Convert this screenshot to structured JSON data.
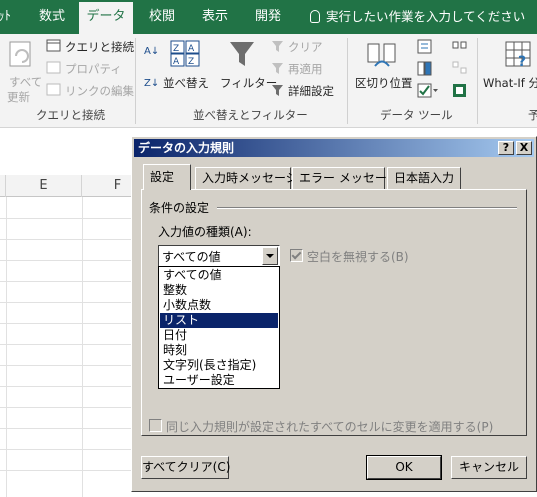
{
  "ribbon": {
    "tabs": [
      {
        "label": "ｯﾄ"
      },
      {
        "label": "数式"
      },
      {
        "label": "データ"
      },
      {
        "label": "校閲"
      },
      {
        "label": "表示"
      },
      {
        "label": "開発"
      }
    ],
    "tell_me": "実行したい作業を入力してください",
    "get_transform": {
      "refresh_all_line1": "すべて",
      "refresh_all_line2": "更新",
      "queries_connections": "クエリと接続",
      "properties": "プロパティ",
      "edit_links": "リンクの編集",
      "group_label": "クエリと接続"
    },
    "sort_filter": {
      "sort": "並べ替え",
      "filter": "フィルター",
      "clear": "クリア",
      "reapply": "再適用",
      "advanced": "詳細設定",
      "group_label": "並べ替えとフィルター"
    },
    "data_tools": {
      "text_to_columns": "区切り位置",
      "group_label": "データ ツール"
    },
    "forecast": {
      "what_if": "What-If 分",
      "group_label_partial": "予"
    }
  },
  "sheet": {
    "columns": [
      "E",
      "F"
    ]
  },
  "dialog": {
    "title": "データの入力規則",
    "help_btn": "?",
    "close_btn": "X",
    "tabs": [
      "設定",
      "入力時メッセージ",
      "エラー メッセージ",
      "日本語入力"
    ],
    "section_title": "条件の設定",
    "allow_label": "入力値の種類(A):",
    "allow_value": "すべての値",
    "allow_options": [
      "すべての値",
      "整数",
      "小数点数",
      "リスト",
      "日付",
      "時刻",
      "文字列(長さ指定)",
      "ユーザー設定"
    ],
    "selected_option": "リスト",
    "ignore_blank_label": "空白を無視する(B)",
    "apply_all_label": "同じ入力規則が設定されたすべてのセルに変更を適用する(P)",
    "clear_all_btn": "すべてクリア(C)",
    "ok_btn": "OK",
    "cancel_btn": "キャンセル"
  },
  "colors": {
    "excel_green": "#217346",
    "dialog_face": "#d4d0c8",
    "title_dark": "#0a246a",
    "title_light": "#a6caf0"
  }
}
